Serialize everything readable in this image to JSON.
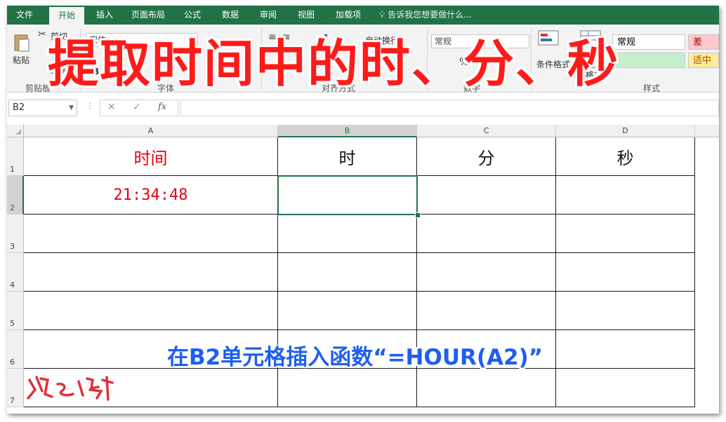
{
  "ribbon_tabs": [
    {
      "label": "文件"
    },
    {
      "label": "开始"
    },
    {
      "label": "插入"
    },
    {
      "label": "页面布局"
    },
    {
      "label": "公式"
    },
    {
      "label": "数据"
    },
    {
      "label": "审阅"
    },
    {
      "label": "视图"
    },
    {
      "label": "加载项"
    }
  ],
  "tell_me": "告诉我您想要做什么...",
  "ribbon": {
    "paste": "粘贴",
    "cut": "剪切",
    "format_painter": "式刷",
    "font_name": "宋体",
    "wrap_text": "自动换行",
    "number_format": "常规",
    "percent": "%",
    "cond_format": "条件格式",
    "table_format_1": "套用",
    "table_format_2": "表格格式",
    "style_normal": "常规",
    "style_bad": "差",
    "style_neutral": "适中",
    "groups": {
      "clipboard": "剪贴板",
      "font": "字体",
      "alignment": "对齐方式",
      "number": "数字",
      "styles": "样式"
    }
  },
  "colors": {
    "excel_green": "#217346",
    "title_red": "#ff1a1a",
    "tip_blue": "#1e5ff0",
    "style_bad_bg": "#ffc7ce",
    "style_neutral_bg": "#ffeb9c"
  },
  "name_box": "B2",
  "formula_icons": {
    "cancel": "✕",
    "enter": "✓",
    "fx": "fx"
  },
  "columns": [
    "A",
    "B",
    "C",
    "D"
  ],
  "rows": [
    "1",
    "2",
    "3",
    "4",
    "5",
    "6",
    "7"
  ],
  "cells": {
    "A1": "时间",
    "B1": "时",
    "C1": "分",
    "D1": "秒",
    "A2": "21:34:48"
  },
  "selected_cell": "B2",
  "overlay_title": "提取时间中的时、分、秒",
  "overlay_tip": "在B2单元格插入函数“=HOUR(A2)”",
  "signature": "然之峰"
}
